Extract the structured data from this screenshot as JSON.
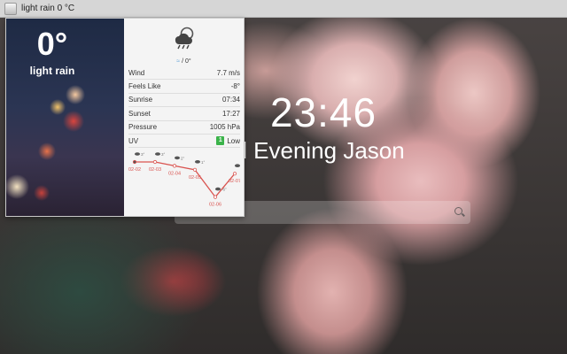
{
  "window": {
    "title": "light rain 0 °C"
  },
  "background": {
    "time": "23:46",
    "greeting": "od Evening Jason",
    "search": {
      "placeholder": ""
    }
  },
  "weather": {
    "temperature": "0°",
    "condition": "light rain",
    "icon": "rain-cloud-icon",
    "sub_line": "/ 0°",
    "details": [
      {
        "label": "Wind",
        "value": "7.7 m/s"
      },
      {
        "label": "Feels Like",
        "value": "-8°"
      },
      {
        "label": "Sunrise",
        "value": "07:34"
      },
      {
        "label": "Sunset",
        "value": "17:27"
      },
      {
        "label": "Pressure",
        "value": "1005 hPa"
      }
    ],
    "uv": {
      "label": "UV",
      "index": "1",
      "text": "Low",
      "color": "#3bb34a"
    },
    "forecast": {
      "line_color": "#d9534f",
      "dates": [
        "02-02",
        "02-03",
        "02-04",
        "02-05",
        "02-06",
        "02-07"
      ],
      "temps": [
        "3°",
        "3°",
        "2°",
        "1°",
        "-6°",
        "0°"
      ]
    }
  }
}
